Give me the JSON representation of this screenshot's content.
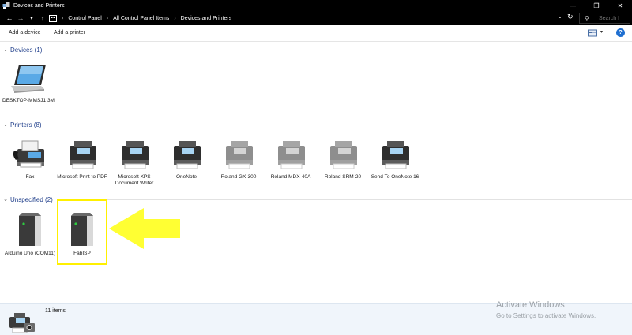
{
  "window": {
    "title": "Devices and Printers",
    "controls": {
      "minimize": "—",
      "maximize": "❐",
      "close": "✕"
    }
  },
  "address": {
    "breadcrumbs": [
      "Control Panel",
      "All Control Panel Items",
      "Devices and Printers"
    ],
    "search_placeholder": "Search De..."
  },
  "commands": {
    "add_device": "Add a device",
    "add_printer": "Add a printer",
    "help": "?"
  },
  "groups": {
    "devices": {
      "title": "Devices (1)",
      "items": [
        {
          "label": "DESKTOP-MMSJ1 3M",
          "icon": "laptop-icon"
        }
      ]
    },
    "printers": {
      "title": "Printers (8)",
      "items": [
        {
          "label": "Fax",
          "icon": "fax-icon"
        },
        {
          "label": "Microsoft Print to PDF",
          "icon": "printer-icon"
        },
        {
          "label": "Microsoft XPS Document Writer",
          "icon": "printer-icon"
        },
        {
          "label": "OneNote",
          "icon": "printer-icon"
        },
        {
          "label": "Roland GX-300",
          "icon": "printer-icon"
        },
        {
          "label": "Roland MDX-40A",
          "icon": "printer-icon"
        },
        {
          "label": "Roland SRM-20",
          "icon": "printer-icon"
        },
        {
          "label": "Send To OneNote 16",
          "icon": "printer-icon"
        }
      ]
    },
    "unspecified": {
      "title": "Unspecified (2)",
      "items": [
        {
          "label": "Arduino Uno (COM11)",
          "icon": "device-tower-icon"
        },
        {
          "label": "FabISP",
          "icon": "device-tower-icon"
        }
      ]
    }
  },
  "details": {
    "item_count": "11 items"
  },
  "watermark": {
    "line1": "Activate Windows",
    "line2": "Go to Settings to activate Windows."
  },
  "colors": {
    "highlight": "#fff000",
    "arrow": "#ffff33",
    "group_title": "#1e3d8a"
  }
}
